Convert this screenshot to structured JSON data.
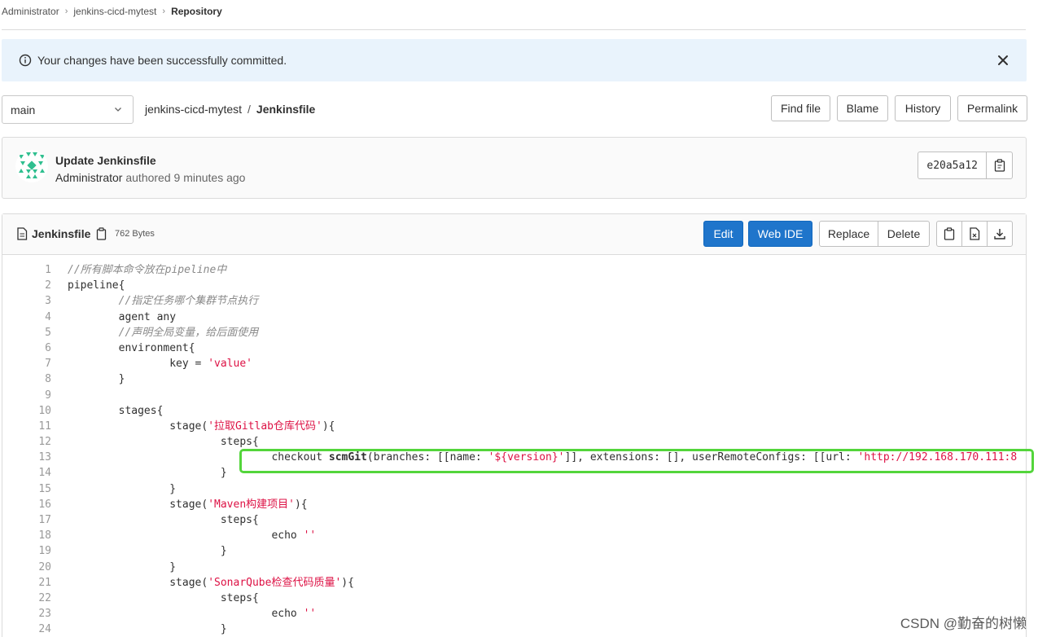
{
  "breadcrumb": [
    "Administrator",
    "jenkins-cicd-mytest",
    "Repository"
  ],
  "alert": {
    "message": "Your changes have been successfully committed."
  },
  "branch": {
    "value": "main"
  },
  "path": {
    "repo": "jenkins-cicd-mytest",
    "file": "Jenkinsfile"
  },
  "file_actions": {
    "find_file": "Find file",
    "blame": "Blame",
    "history": "History",
    "permalink": "Permalink"
  },
  "commit": {
    "title": "Update Jenkinsfile",
    "author": "Administrator",
    "meta": "authored 9 minutes ago",
    "sha": "e20a5a12"
  },
  "file": {
    "name": "Jenkinsfile",
    "size": "762 Bytes",
    "edit": "Edit",
    "web_ide": "Web IDE",
    "replace": "Replace",
    "delete": "Delete"
  },
  "code_lines": [
    "//所有脚本命令放在pipeline中",
    "pipeline{",
    "        //指定任务哪个集群节点执行",
    "        agent any",
    "        //声明全局变量，给后面使用",
    "        environment{",
    "                key = 'value'",
    "        }",
    "",
    "        stages{",
    "                stage('拉取Gitlab仓库代码'){",
    "                        steps{",
    "                                checkout scmGit(branches: [[name: '${version}']], extensions: [], userRemoteConfigs: [[url: 'http://192.168.170.111:8",
    "                        }",
    "                }",
    "                stage('Maven构建项目'){",
    "                        steps{",
    "                                echo ''",
    "                        }",
    "                }",
    "                stage('SonarQube检查代码质量'){",
    "                        steps{",
    "                                echo ''",
    "                        }"
  ],
  "watermark": "CSDN @勤奋的树懒",
  "colors": {
    "primary": "#1f75cb",
    "alert_bg": "#e9f3fc",
    "highlight": "#53d53b",
    "string": "#dd1144"
  }
}
